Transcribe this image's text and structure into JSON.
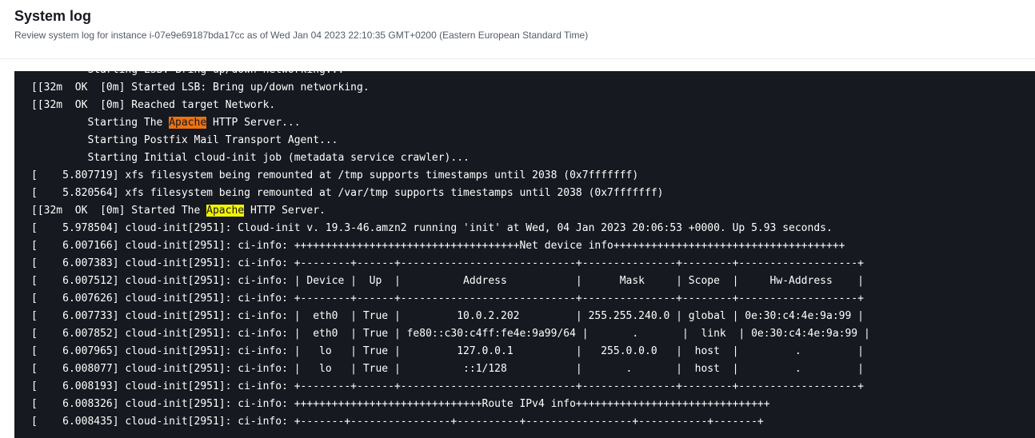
{
  "header": {
    "title": "System log",
    "subtitle": "Review system log for instance i-07e9e69187bda17cc as of Wed Jan 04 2023 22:10:35 GMT+0200 (Eastern European Standard Time)"
  },
  "search": {
    "term": "Apache"
  },
  "colors": {
    "log_background": "#16191f",
    "log_text": "#ffffff",
    "highlight_current": "#ec7211",
    "highlight_match": "#f2f200"
  },
  "log": {
    "lines": [
      "         Starting LSB: Bring up/down networking...",
      "[\u001b[32m  OK  \u001b[0m] Started LSB: Bring up/down networking.",
      "[\u001b[32m  OK  \u001b[0m] Reached target Network.",
      "         Starting The Apache HTTP Server...",
      "         Starting Postfix Mail Transport Agent...",
      "         Starting Initial cloud-init job (metadata service crawler)...",
      "[    5.807719] xfs filesystem being remounted at /tmp supports timestamps until 2038 (0x7fffffff)",
      "[    5.820564] xfs filesystem being remounted at /var/tmp supports timestamps until 2038 (0x7fffffff)",
      "[\u001b[32m  OK  \u001b[0m] Started The Apache HTTP Server.",
      "[    5.978504] cloud-init[2951]: Cloud-init v. 19.3-46.amzn2 running 'init' at Wed, 04 Jan 2023 20:06:53 +0000. Up 5.93 seconds.",
      "[    6.007166] cloud-init[2951]: ci-info: ++++++++++++++++++++++++++++++++++++Net device info+++++++++++++++++++++++++++++++++++++",
      "[    6.007383] cloud-init[2951]: ci-info: +--------+------+----------------------------+---------------+--------+-------------------+",
      "[    6.007512] cloud-init[2951]: ci-info: | Device |  Up  |          Address           |      Mask     | Scope  |     Hw-Address    |",
      "[    6.007626] cloud-init[2951]: ci-info: +--------+------+----------------------------+---------------+--------+-------------------+",
      "[    6.007733] cloud-init[2951]: ci-info: |  eth0  | True |         10.0.2.202         | 255.255.240.0 | global | 0e:30:c4:4e:9a:99 |",
      "[    6.007852] cloud-init[2951]: ci-info: |  eth0  | True | fe80::c30:c4ff:fe4e:9a99/64 |       .       |  link  | 0e:30:c4:4e:9a:99 |",
      "[    6.007965] cloud-init[2951]: ci-info: |   lo   | True |         127.0.0.1          |   255.0.0.0   |  host  |         .         |",
      "[    6.008077] cloud-init[2951]: ci-info: |   lo   | True |          ::1/128           |       .       |  host  |         .         |",
      "[    6.008193] cloud-init[2951]: ci-info: +--------+------+----------------------------+---------------+--------+-------------------+",
      "[    6.008326] cloud-init[2951]: ci-info: ++++++++++++++++++++++++++++++Route IPv4 info+++++++++++++++++++++++++++++++",
      "[    6.008435] cloud-init[2951]: ci-info: +-------+----------------+----------+-----------------+-----------+-------+"
    ]
  }
}
